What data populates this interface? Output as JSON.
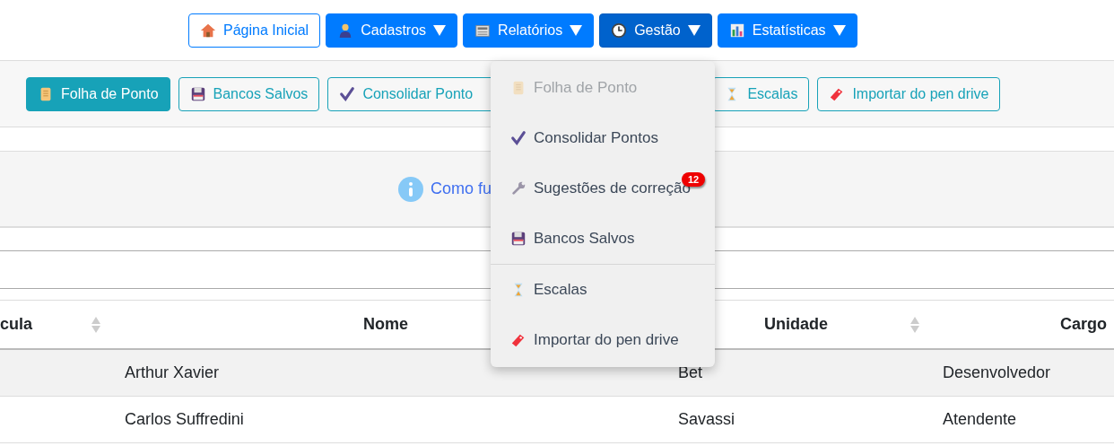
{
  "nav": [
    {
      "label": "Página Inicial",
      "kind": "outline",
      "selected": false
    },
    {
      "label": "Cadastros",
      "kind": "dropdown",
      "selected": false
    },
    {
      "label": "Relatórios",
      "kind": "dropdown",
      "selected": false
    },
    {
      "label": "Gestão",
      "kind": "dropdown",
      "selected": true
    },
    {
      "label": "Estatísticas",
      "kind": "dropdown",
      "selected": false
    }
  ],
  "toolbar": [
    {
      "label": "Folha de Ponto",
      "selected": true
    },
    {
      "label": "Bancos Salvos",
      "selected": false
    },
    {
      "label": "Consolidar Ponto",
      "selected": false
    },
    {
      "label": "Escalas",
      "selected": false
    },
    {
      "label": "Importar do pen drive",
      "selected": false
    }
  ],
  "info": {
    "text": "Como fu"
  },
  "table": {
    "columns": [
      {
        "label": "cula",
        "sortable": true
      },
      {
        "label": "Nome",
        "sortable": false
      },
      {
        "label": "Unidade",
        "sortable": true
      },
      {
        "label": "Cargo",
        "sortable": false
      }
    ],
    "rows": [
      {
        "nome": "Arthur Xavier",
        "unidade": "Bet",
        "cargo": "Desenvolvedor"
      },
      {
        "nome": "Carlos Suffredini",
        "unidade": "Savassi",
        "cargo": "Atendente"
      }
    ]
  },
  "menu": {
    "items": [
      {
        "label": "Folha de Ponto",
        "disabled": true,
        "divider_before": false
      },
      {
        "label": "Consolidar Pontos",
        "disabled": false,
        "divider_before": false
      },
      {
        "label": "Sugestões de correção",
        "disabled": false,
        "divider_before": false,
        "badge": "12"
      },
      {
        "label": "Bancos Salvos",
        "disabled": false,
        "divider_before": false
      },
      {
        "label": "Escalas",
        "disabled": false,
        "divider_before": true
      },
      {
        "label": "Importar do pen drive",
        "disabled": false,
        "divider_before": false
      }
    ]
  }
}
